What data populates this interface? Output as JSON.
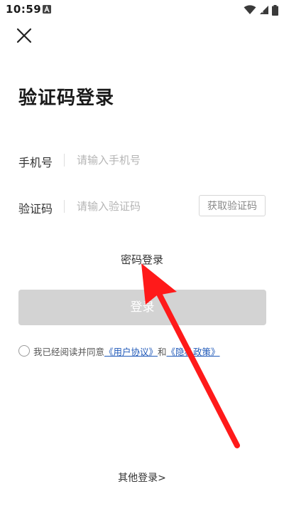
{
  "status_bar": {
    "time": "10:59",
    "notification_icon": "a-notification-icon",
    "wifi_icon": "wifi-icon",
    "signal_icon": "signal-icon",
    "battery_icon": "battery-icon"
  },
  "close_icon": "close-icon",
  "title": "验证码登录",
  "phone": {
    "label": "手机号",
    "value": "",
    "placeholder": "请输入手机号"
  },
  "code": {
    "label": "验证码",
    "value": "",
    "placeholder": "请输入验证码",
    "get_code_label": "获取验证码"
  },
  "password_login_label": "密码登录",
  "login_button_label": "登录",
  "agreement": {
    "checked": false,
    "prefix": "我已经阅读并同意",
    "user_agreement": "《用户协议》",
    "conjunction": "和",
    "privacy_policy": "《隐私政策》"
  },
  "other_login_label": "其他登录>",
  "colors": {
    "login_button_disabled": "#d3d3d3",
    "link": "#1f58b8",
    "annotation_arrow": "#ff1a1a"
  }
}
